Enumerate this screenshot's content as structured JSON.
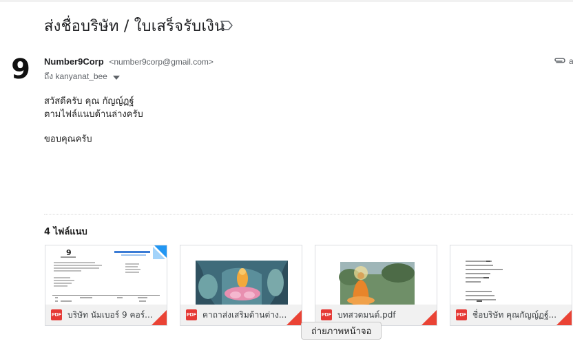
{
  "email": {
    "subject": "ส่งชื่อบริษัท / ใบเสร็จรับเงิน",
    "sender_name": "Number9Corp",
    "sender_email": "<number9corp@gmail.com>",
    "to_line": "ถึง kanyanat_bee",
    "clip_text": "a",
    "body_lines": [
      "สวัสดีครับ คุณ กัญญ์ฏฐ์",
      "ตามไฟล์แนบด้านล่างครับ",
      "ขอบคุณครับ"
    ],
    "avatar_text": "9"
  },
  "attachments": {
    "count_label": "4 ไฟล์แนบ",
    "items": [
      {
        "name": "บริษัท นัมเบอร์ 9 คอร์...",
        "type": "PDF"
      },
      {
        "name": "คาถาส่งเสริมด้านต่าง...",
        "type": "PDF"
      },
      {
        "name": "บทสวดมนต์.pdf",
        "type": "PDF"
      },
      {
        "name": "ชื่อบริษัท คุณกัญญ์ฏฐ์...",
        "type": "PDF"
      }
    ]
  },
  "tooltip": {
    "text": "ถ่ายภาพหน้าจอ"
  },
  "colors": {
    "pdf_red": "#ea4335",
    "text_dark": "#202124",
    "text_muted": "#5f6368"
  }
}
